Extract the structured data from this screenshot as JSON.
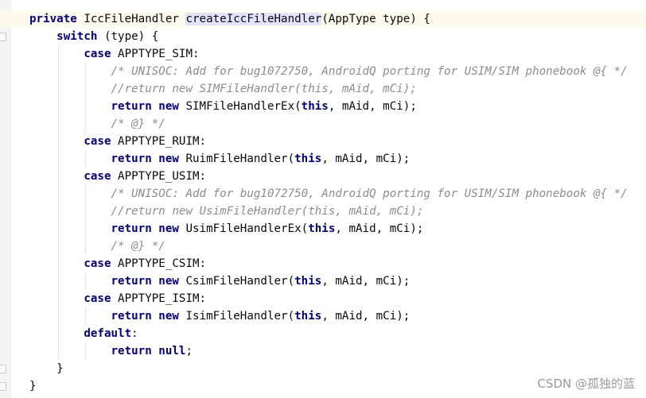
{
  "editor": {
    "lines": [
      {
        "indent": 0,
        "current": true,
        "tokens": [
          {
            "t": "private",
            "c": "kw"
          },
          {
            "t": " IccFileHandler "
          },
          {
            "t": "createIccFileHandler",
            "c": "hl"
          },
          {
            "t": "(AppType type) {"
          }
        ]
      },
      {
        "indent": 1,
        "tokens": [
          {
            "t": "switch",
            "c": "kw"
          },
          {
            "t": " (type) {"
          }
        ]
      },
      {
        "indent": 2,
        "tokens": [
          {
            "t": "case",
            "c": "kw"
          },
          {
            "t": " APPTYPE_SIM:"
          }
        ]
      },
      {
        "indent": 3,
        "tokens": [
          {
            "t": "/* UNISOC: Add for bug1072750, AndroidQ porting for USIM/SIM phonebook @{ */",
            "c": "cm"
          }
        ]
      },
      {
        "indent": 3,
        "tokens": [
          {
            "t": "//return new SIMFileHandler(this, mAid, mCi);",
            "c": "cm"
          }
        ]
      },
      {
        "indent": 3,
        "tokens": [
          {
            "t": "return",
            "c": "kw"
          },
          {
            "t": " "
          },
          {
            "t": "new",
            "c": "kw"
          },
          {
            "t": " SIMFileHandlerEx("
          },
          {
            "t": "this",
            "c": "kw"
          },
          {
            "t": ", mAid, mCi);"
          }
        ]
      },
      {
        "indent": 3,
        "tokens": [
          {
            "t": "/* @} */",
            "c": "cm"
          }
        ]
      },
      {
        "indent": 2,
        "tokens": [
          {
            "t": "case",
            "c": "kw"
          },
          {
            "t": " APPTYPE_RUIM:"
          }
        ]
      },
      {
        "indent": 3,
        "tokens": [
          {
            "t": "return",
            "c": "kw"
          },
          {
            "t": " "
          },
          {
            "t": "new",
            "c": "kw"
          },
          {
            "t": " RuimFileHandler("
          },
          {
            "t": "this",
            "c": "kw"
          },
          {
            "t": ", mAid, mCi);"
          }
        ]
      },
      {
        "indent": 2,
        "tokens": [
          {
            "t": "case",
            "c": "kw"
          },
          {
            "t": " APPTYPE_USIM:"
          }
        ]
      },
      {
        "indent": 3,
        "tokens": [
          {
            "t": "/* UNISOC: Add for bug1072750, AndroidQ porting for USIM/SIM phonebook @{ */",
            "c": "cm"
          }
        ]
      },
      {
        "indent": 3,
        "tokens": [
          {
            "t": "//return new UsimFileHandler(this, mAid, mCi);",
            "c": "cm"
          }
        ]
      },
      {
        "indent": 3,
        "tokens": [
          {
            "t": "return",
            "c": "kw"
          },
          {
            "t": " "
          },
          {
            "t": "new",
            "c": "kw"
          },
          {
            "t": " UsimFileHandlerEx("
          },
          {
            "t": "this",
            "c": "kw"
          },
          {
            "t": ", mAid, mCi);"
          }
        ]
      },
      {
        "indent": 3,
        "tokens": [
          {
            "t": "/* @} */",
            "c": "cm"
          }
        ]
      },
      {
        "indent": 2,
        "tokens": [
          {
            "t": "case",
            "c": "kw"
          },
          {
            "t": " APPTYPE_CSIM:"
          }
        ]
      },
      {
        "indent": 3,
        "tokens": [
          {
            "t": "return",
            "c": "kw"
          },
          {
            "t": " "
          },
          {
            "t": "new",
            "c": "kw"
          },
          {
            "t": " CsimFileHandler("
          },
          {
            "t": "this",
            "c": "kw"
          },
          {
            "t": ", mAid, mCi);"
          }
        ]
      },
      {
        "indent": 2,
        "tokens": [
          {
            "t": "case",
            "c": "kw"
          },
          {
            "t": " APPTYPE_ISIM:"
          }
        ]
      },
      {
        "indent": 3,
        "tokens": [
          {
            "t": "return",
            "c": "kw"
          },
          {
            "t": " "
          },
          {
            "t": "new",
            "c": "kw"
          },
          {
            "t": " IsimFileHandler("
          },
          {
            "t": "this",
            "c": "kw"
          },
          {
            "t": ", mAid, mCi);"
          }
        ]
      },
      {
        "indent": 2,
        "tokens": [
          {
            "t": "default",
            "c": "kw"
          },
          {
            "t": ":"
          }
        ]
      },
      {
        "indent": 3,
        "tokens": [
          {
            "t": "return",
            "c": "kw"
          },
          {
            "t": " "
          },
          {
            "t": "null",
            "c": "kw"
          },
          {
            "t": ";"
          }
        ]
      },
      {
        "indent": 1,
        "tokens": [
          {
            "t": "}"
          }
        ]
      },
      {
        "indent": 0,
        "tokens": [
          {
            "t": "}"
          }
        ]
      }
    ]
  },
  "gutter": {
    "intention_icon": "lightbulb-icon"
  },
  "watermark": "CSDN @孤独的蓝",
  "colors": {
    "keyword": "#000080",
    "comment": "#8c8c8c",
    "highlight": "#e3e3ff",
    "text": "#080808"
  }
}
